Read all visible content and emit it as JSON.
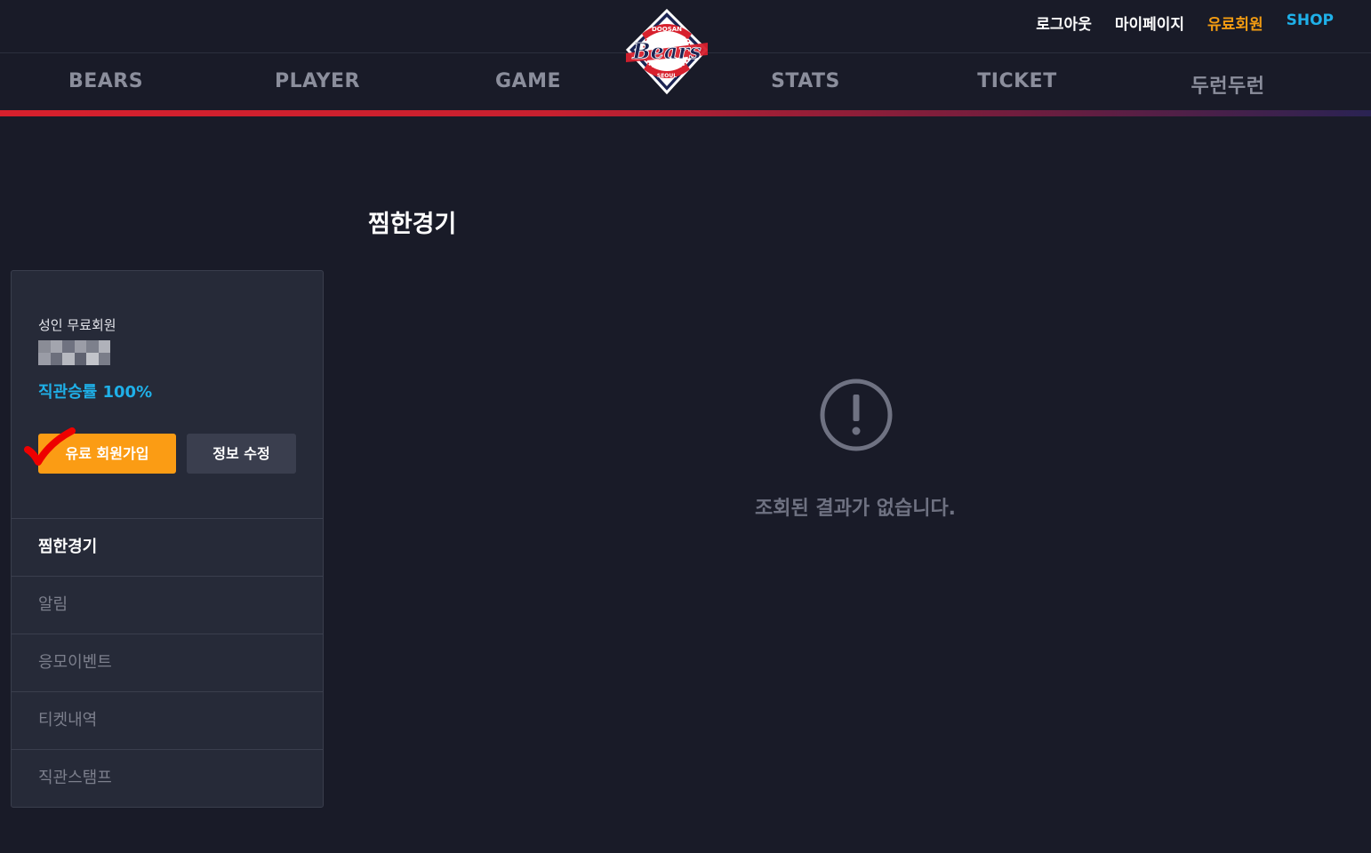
{
  "header": {
    "util_links": {
      "logout": "로그아웃",
      "mypage": "마이페이지",
      "premium": "유료회원",
      "shop": "SHOP"
    },
    "logo": {
      "icon": "bears-logo",
      "top_text": "DOOSAN",
      "main_text": "Bears",
      "bottom_text": "SEOUL"
    },
    "nav": [
      "BEARS",
      "PLAYER",
      "GAME",
      "STATS",
      "TICKET",
      "두런두런"
    ]
  },
  "colors": {
    "background": "#191b28",
    "accent_orange": "#fb9c14",
    "accent_blue": "#1fb0e8",
    "brand_red": "#d7202d"
  },
  "page": {
    "title": "찜한경기"
  },
  "sidebar": {
    "member_type": "성인 무료회원",
    "win_rate": "직관승률 100%",
    "join_button": "유료 회원가입",
    "edit_button": "정보 수정",
    "menu": [
      "찜한경기",
      "알림",
      "응모이벤트",
      "티켓내역",
      "직관스탬프"
    ],
    "active_index": 0
  },
  "empty_state": {
    "icon": "exclamation-circle-icon",
    "message": "조회된 결과가 없습니다."
  }
}
